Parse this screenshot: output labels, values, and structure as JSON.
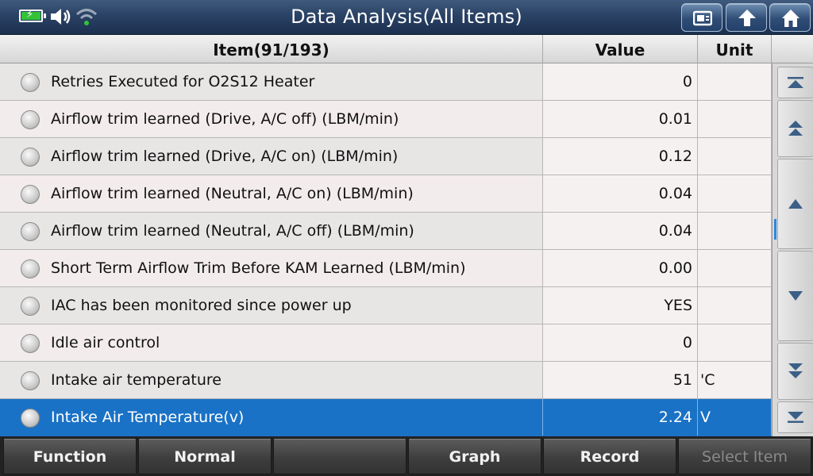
{
  "app": {
    "title": "Data Analysis(All Items)"
  },
  "status_icons": [
    "battery-charging-icon",
    "speaker-icon",
    "wifi-icon"
  ],
  "top_buttons": [
    "screenshot-icon",
    "back-arrow-icon",
    "home-icon"
  ],
  "table": {
    "headers": {
      "item": "Item(91/193)",
      "value": "Value",
      "unit": "Unit"
    },
    "rows": [
      {
        "item": "Retries Executed for O2S12 Heater",
        "value": "0",
        "unit": ""
      },
      {
        "item": "Airflow trim learned (Drive, A/C off) (LBM/min)",
        "value": "0.01",
        "unit": ""
      },
      {
        "item": "Airflow trim learned (Drive, A/C on) (LBM/min)",
        "value": "0.12",
        "unit": ""
      },
      {
        "item": "Airflow trim learned (Neutral, A/C on) (LBM/min)",
        "value": "0.04",
        "unit": ""
      },
      {
        "item": "Airflow trim learned (Neutral, A/C off) (LBM/min)",
        "value": "0.04",
        "unit": ""
      },
      {
        "item": "Short Term Airflow Trim Before KAM Learned (LBM/min)",
        "value": "0.00",
        "unit": ""
      },
      {
        "item": "IAC has been monitored since power up",
        "value": "YES",
        "unit": ""
      },
      {
        "item": "Idle air control",
        "value": "0",
        "unit": ""
      },
      {
        "item": "Intake air temperature",
        "value": "51",
        "unit": "'C"
      },
      {
        "item": "Intake Air Temperature(v)",
        "value": "2.24",
        "unit": "V"
      }
    ],
    "selected_index": 9
  },
  "scroll_buttons": [
    "scroll-top-icon",
    "page-up-icon",
    "line-up-icon",
    "line-down-icon",
    "page-down-icon",
    "scroll-bottom-icon"
  ],
  "toolbar": {
    "buttons": [
      "Function",
      "Normal",
      "",
      "Graph",
      "Record",
      "Select Item"
    ]
  },
  "colors": {
    "title_bar": "#2a4265",
    "selected_row": "#1a72c6",
    "battery_fill": "#33c23a"
  }
}
